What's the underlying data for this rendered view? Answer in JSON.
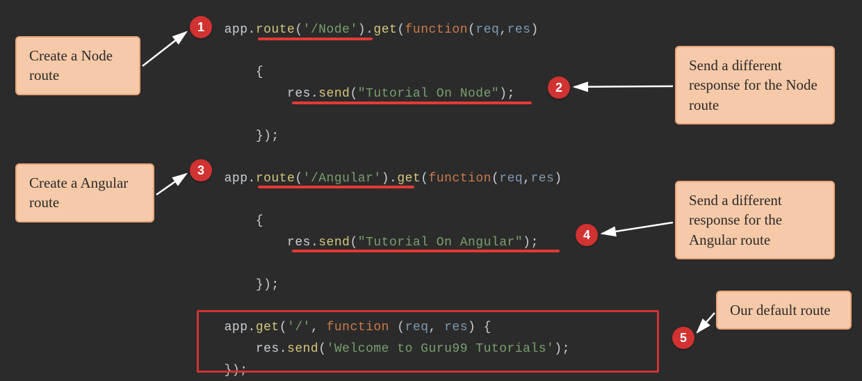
{
  "code": {
    "l1_app": "app",
    "l1_route": "route",
    "l1_path": "'/Node'",
    "l1_get": "get",
    "l1_fn": "function",
    "l1_req": "req",
    "l1_res": "res",
    "l3_open": "{",
    "l4_res": "res",
    "l4_send": "send",
    "l4_str": "\"Tutorial On Node\"",
    "l6_close": "});",
    "l8_app": "app",
    "l8_route": "route",
    "l8_path": "'/Angular'",
    "l8_get": "get",
    "l8_fn": "function",
    "l8_req": "req",
    "l8_res": "res",
    "l10_open": "{",
    "l11_res": "res",
    "l11_send": "send",
    "l11_str": "\"Tutorial On Angular\"",
    "l13_close": "});",
    "l15_app": "app",
    "l15_get": "get",
    "l15_path": "'/'",
    "l15_fn": "function",
    "l15_req": "req",
    "l15_res": "res",
    "l15_brace": " {",
    "l16_res": "res",
    "l16_send": "send",
    "l16_str": "'Welcome to Guru99 Tutorials'",
    "l17_close": "});"
  },
  "markers": {
    "m1": "1",
    "m2": "2",
    "m3": "3",
    "m4": "4",
    "m5": "5"
  },
  "callouts": {
    "c1": "Create a Node route",
    "c2": "Send a different response for the Node route",
    "c3": "Create a Angular route",
    "c4": "Send a different response for the Angular route",
    "c5": "Our default route"
  }
}
